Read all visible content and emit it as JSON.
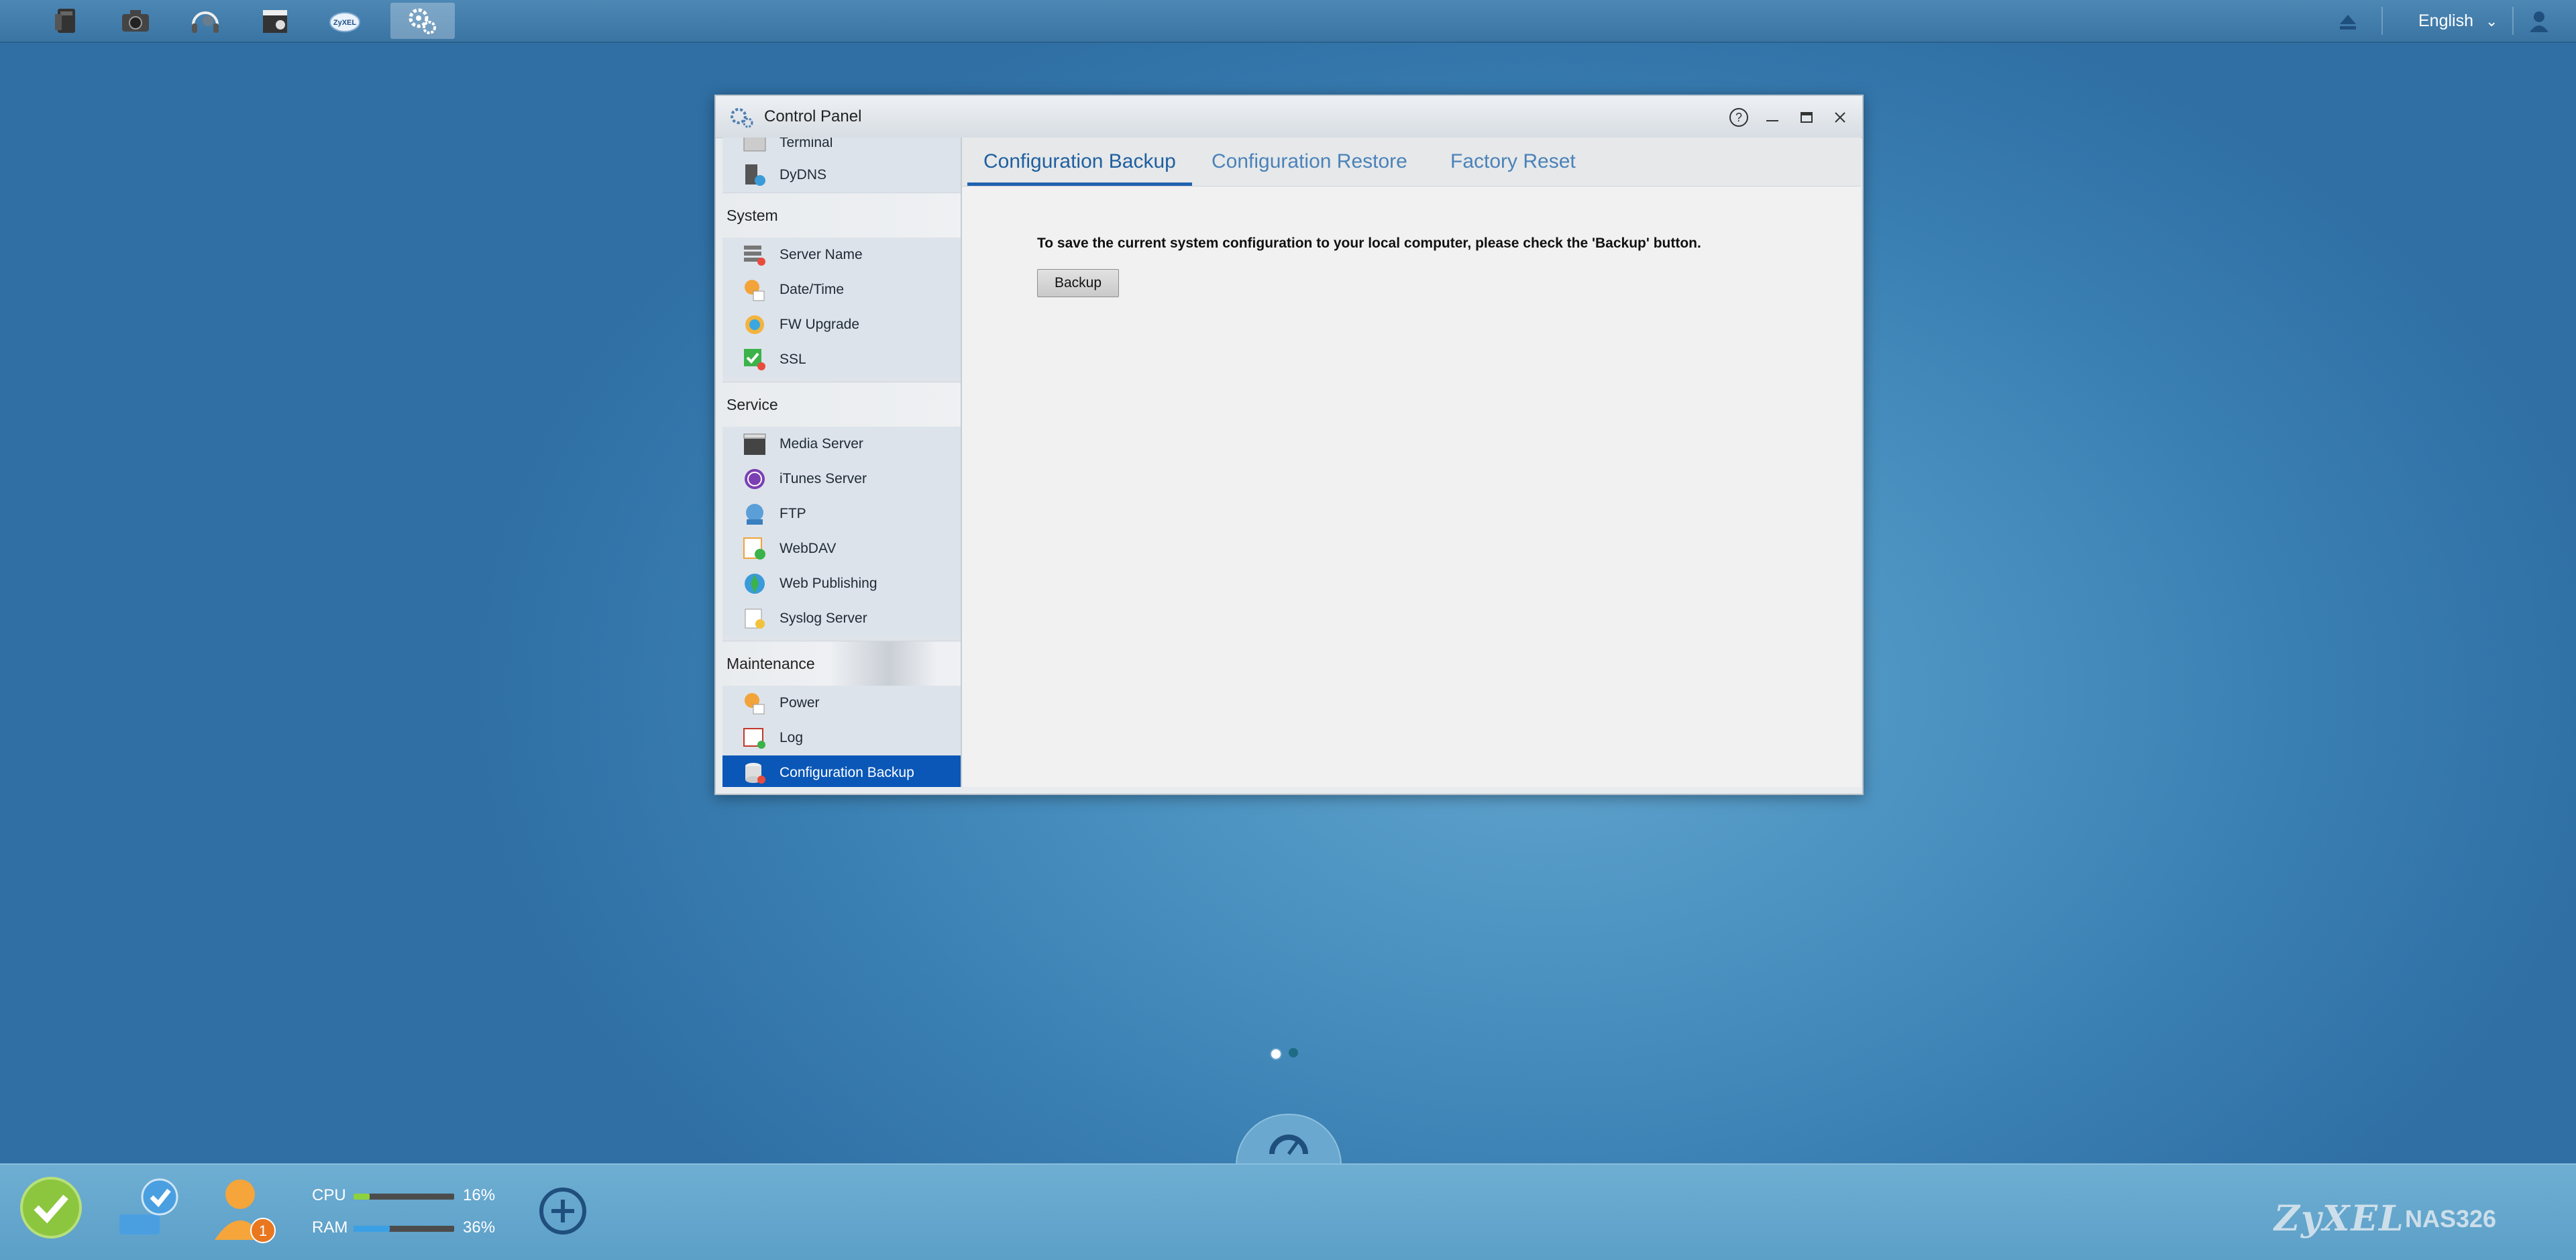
{
  "topbar": {
    "apps": [
      {
        "name": "file-browser-icon"
      },
      {
        "name": "photo-icon"
      },
      {
        "name": "music-icon"
      },
      {
        "name": "video-icon"
      },
      {
        "name": "zyxel-cloud-icon",
        "text": "ZyXEL"
      },
      {
        "name": "control-panel-icon",
        "active": true
      }
    ],
    "language": "English"
  },
  "window": {
    "title": "Control Panel",
    "sidebar": {
      "partial_item": "Terminal",
      "items_top": [
        {
          "label": "DyDNS",
          "icon": "dydns-icon"
        }
      ],
      "sections": [
        {
          "title": "System",
          "items": [
            {
              "label": "Server Name",
              "icon": "server-name-icon"
            },
            {
              "label": "Date/Time",
              "icon": "date-time-icon"
            },
            {
              "label": "FW Upgrade",
              "icon": "fw-upgrade-icon"
            },
            {
              "label": "SSL",
              "icon": "ssl-icon"
            }
          ]
        },
        {
          "title": "Service",
          "items": [
            {
              "label": "Media Server",
              "icon": "media-server-icon"
            },
            {
              "label": "iTunes Server",
              "icon": "itunes-server-icon"
            },
            {
              "label": "FTP",
              "icon": "ftp-icon"
            },
            {
              "label": "WebDAV",
              "icon": "webdav-icon"
            },
            {
              "label": "Web Publishing",
              "icon": "web-publishing-icon"
            },
            {
              "label": "Syslog Server",
              "icon": "syslog-server-icon"
            }
          ]
        },
        {
          "title": "Maintenance",
          "items": [
            {
              "label": "Power",
              "icon": "power-icon"
            },
            {
              "label": "Log",
              "icon": "log-icon"
            },
            {
              "label": "Configuration Backup",
              "icon": "configuration-backup-icon",
              "active": true
            }
          ]
        }
      ]
    },
    "tabs": [
      "Configuration Backup",
      "Configuration Restore",
      "Factory Reset"
    ],
    "active_tab": "Configuration Backup",
    "description": "To save the current system configuration to your local computer, please check the 'Backup' button.",
    "backup_button": "Backup"
  },
  "page_dots": {
    "count": 2,
    "active": 1
  },
  "tray": {
    "badge_count": "1",
    "cpu": {
      "label": "CPU",
      "value": "16%",
      "fraction": 0.16,
      "color": "#8ed13f"
    },
    "ram": {
      "label": "RAM",
      "value": "36%",
      "fraction": 0.36,
      "color": "#3aa0e6"
    },
    "brand": "ZyXEL",
    "model": "NAS326"
  },
  "colors": {
    "accent": "#0a57b7",
    "tab_active": "#1f63b0"
  }
}
